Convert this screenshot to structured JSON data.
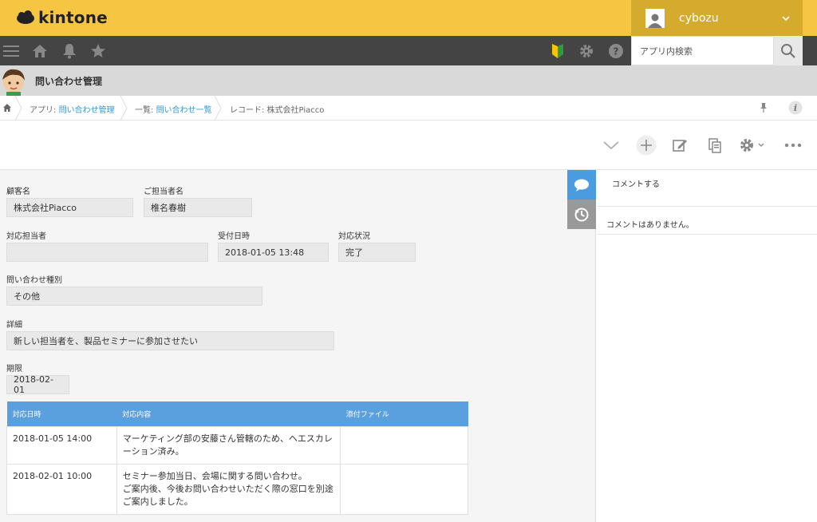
{
  "header": {
    "logo_text": "kintone",
    "user_name": "cybozu",
    "search_placeholder": "アプリ内検索"
  },
  "app": {
    "title": "問い合わせ管理"
  },
  "breadcrumb": {
    "app_prefix": "アプリ: ",
    "app_link": "問い合わせ管理",
    "list_prefix": "一覧: ",
    "list_link": "問い合わせ一覧",
    "record": "レコード: 株式会社Piacco"
  },
  "fields": {
    "customer": {
      "label": "顧客名",
      "value": "株式会社Piacco"
    },
    "contact": {
      "label": "ご担当者名",
      "value": "椎名春樹"
    },
    "assignee": {
      "label": "対応担当者",
      "value": ""
    },
    "received": {
      "label": "受付日時",
      "value": "2018-01-05 13:48"
    },
    "status": {
      "label": "対応状況",
      "value": "完了"
    },
    "inquiry_type": {
      "label": "問い合わせ種別",
      "value": "その他"
    },
    "detail": {
      "label": "詳細",
      "value": "新しい担当者を、製品セミナーに参加させたい"
    },
    "deadline": {
      "label": "期限",
      "value": "2018-02-01"
    }
  },
  "subtable": {
    "headers": [
      "対応日時",
      "対応内容",
      "添付ファイル"
    ],
    "rows": [
      {
        "datetime": "2018-01-05 14:00",
        "content_lines": [
          "マーケティング部の安藤さん管轄のため、ヘエスカレ",
          "ーション済み。"
        ],
        "attachment": ""
      },
      {
        "datetime": "2018-02-01 10:00",
        "content_lines": [
          "セミナー参加当日、会場に関する問い合わせ。",
          "ご案内後、今後お問い合わせいただく際の窓口を別途",
          "ご案内しました。"
        ],
        "attachment": ""
      }
    ]
  },
  "comments": {
    "post_label": "コメントする",
    "empty_text": "コメントはありません。"
  },
  "colors": {
    "header_yellow": "#f6c643",
    "user_area": "#d4ab2c",
    "nav_dark": "#444444",
    "table_header": "#5aa0de",
    "link_blue": "#3498db",
    "side_tab_active": "#4b9be0",
    "side_tab_inactive": "#999999"
  },
  "icons": [
    "menu-icon",
    "home-icon",
    "bell-icon",
    "star-icon",
    "beginner-mark-icon",
    "gear-icon",
    "help-icon",
    "search-icon",
    "pin-icon",
    "info-icon",
    "chevron-down-icon",
    "plus-icon",
    "edit-icon",
    "copy-icon",
    "settings-icon",
    "more-icon",
    "comment-icon",
    "history-icon"
  ]
}
